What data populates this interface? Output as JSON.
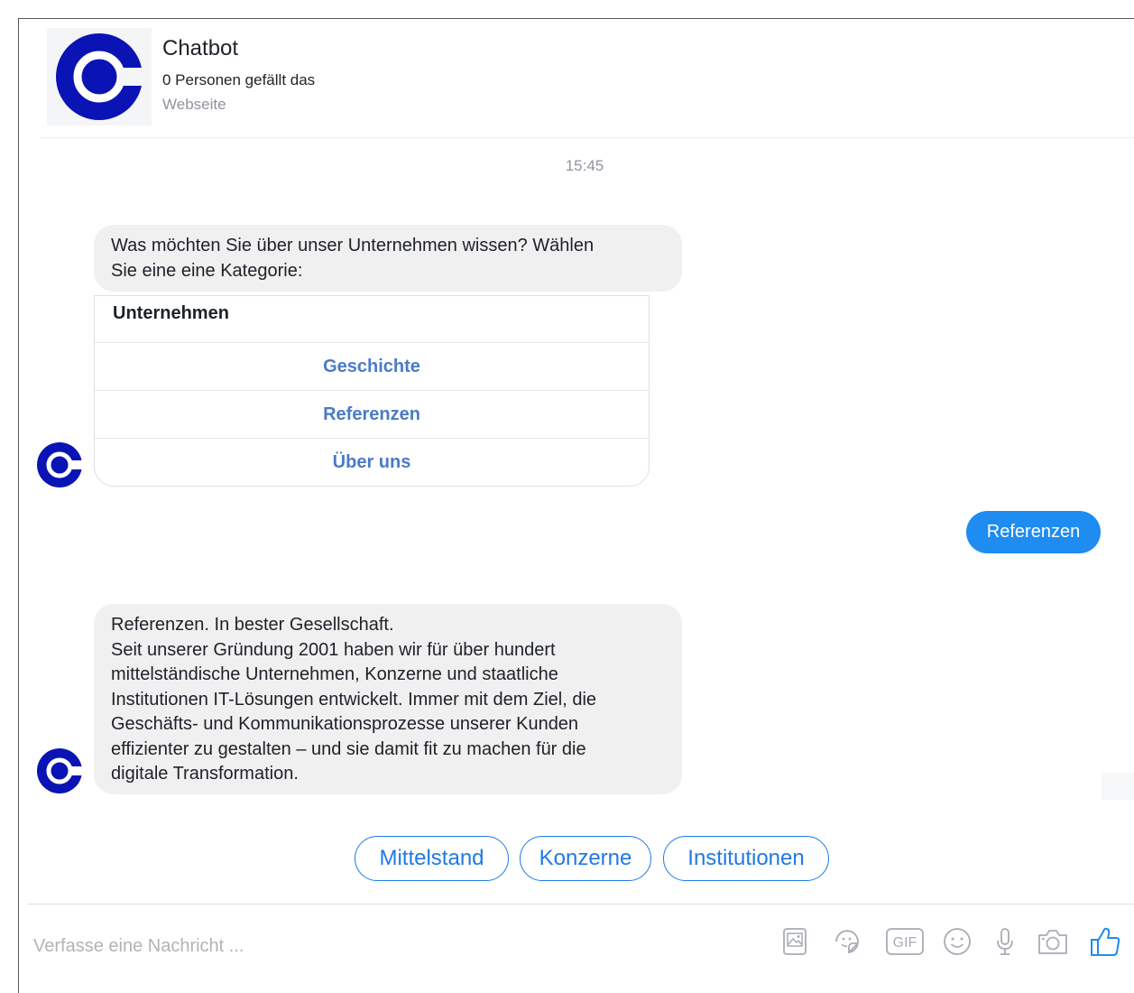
{
  "header": {
    "page_name": "Chatbot",
    "likes": "0 Personen gefällt das",
    "category": "Webseite",
    "logo_icon": "chatbot-logo-icon",
    "brand_color": "#0a14b4"
  },
  "conversation": {
    "timestamp": "15:45",
    "bot_message_1": {
      "line1": "Was möchten Sie über unser Unternehmen wissen? Wählen",
      "line2": "Sie eine eine Kategorie:"
    },
    "card": {
      "title": "Unternehmen",
      "buttons": [
        "Geschichte",
        "Referenzen",
        "Über uns"
      ]
    },
    "user_message": "Referenzen",
    "bot_message_2": {
      "lines": [
        "Referenzen. In bester Gesellschaft.",
        "Seit unserer Gründung 2001 haben wir für über hundert",
        "mittelständische Unternehmen, Konzerne und staatliche",
        "Institutionen IT-Lösungen entwickelt. Immer mit dem Ziel, die",
        "Geschäfts- und Kommunikationsprozesse unserer Kunden",
        "effizienter zu gestalten – und sie damit fit zu machen für die",
        "digitale Transformation."
      ]
    },
    "quick_replies": [
      "Mittelstand",
      "Konzerne",
      "Institutionen"
    ]
  },
  "composer": {
    "placeholder": "Verfasse eine Nachricht ...",
    "tools": [
      "image-icon",
      "sticker-icon",
      "gif-icon",
      "emoji-icon",
      "microphone-icon",
      "camera-icon",
      "thumbs-up-icon"
    ],
    "gif_label": "GIF",
    "accent_color": "#1e8cf1"
  }
}
